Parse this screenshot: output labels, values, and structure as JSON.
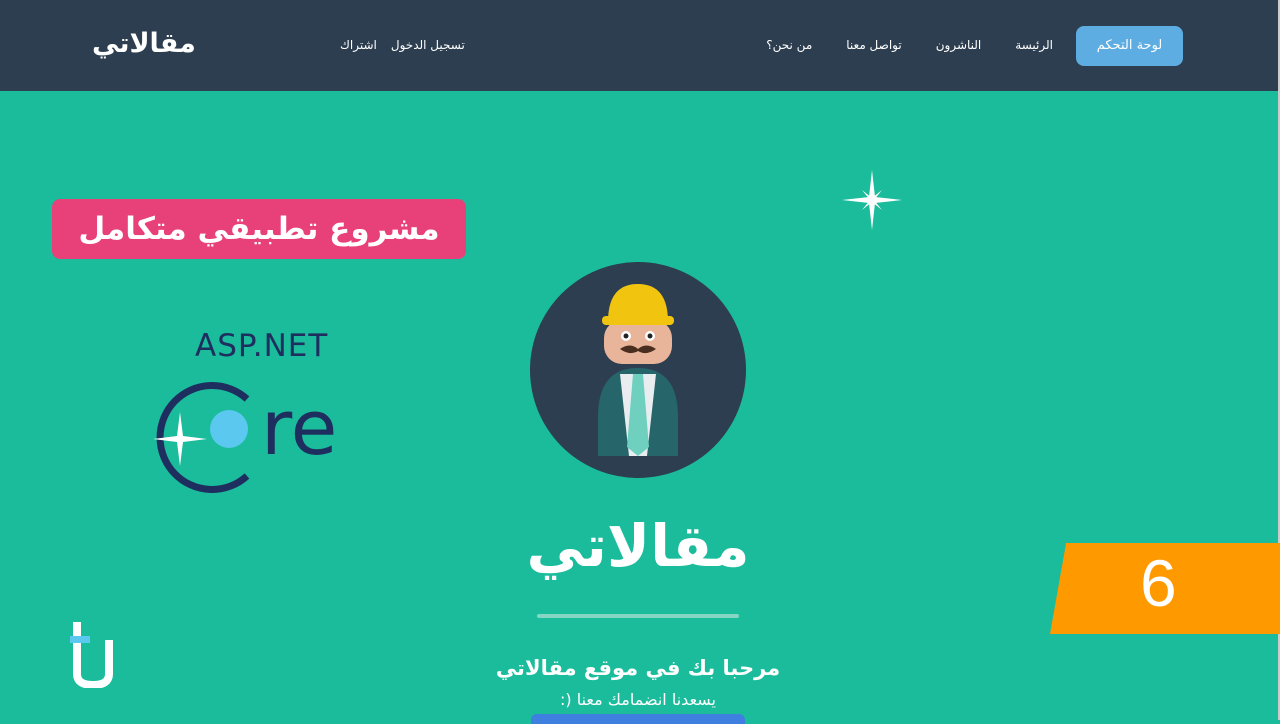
{
  "nav": {
    "brand": "مقالاتي",
    "auth": {
      "login": "تسجيل الدخول",
      "register": "اشتراك"
    },
    "menu": [
      "الرئيسة",
      "الناشرون",
      "تواصل معنا",
      "من نحن؟"
    ],
    "cta": "لوحة التحكم"
  },
  "overlay": {
    "banner": "مشروع تطبيقي متكامل",
    "tech_small": "ASP.NET",
    "tech_large": "re",
    "episode": "6"
  },
  "hero": {
    "title": "مقالاتي",
    "welcome": "مرحبا بك في موقع مقالاتي",
    "join": "يسعدنا انضمامك معنا (:"
  },
  "colors": {
    "accent": "#1abc9c",
    "nav": "#2c3e50",
    "cta": "#5dade2",
    "banner": "#e8417a",
    "badge": "#ff9900"
  }
}
